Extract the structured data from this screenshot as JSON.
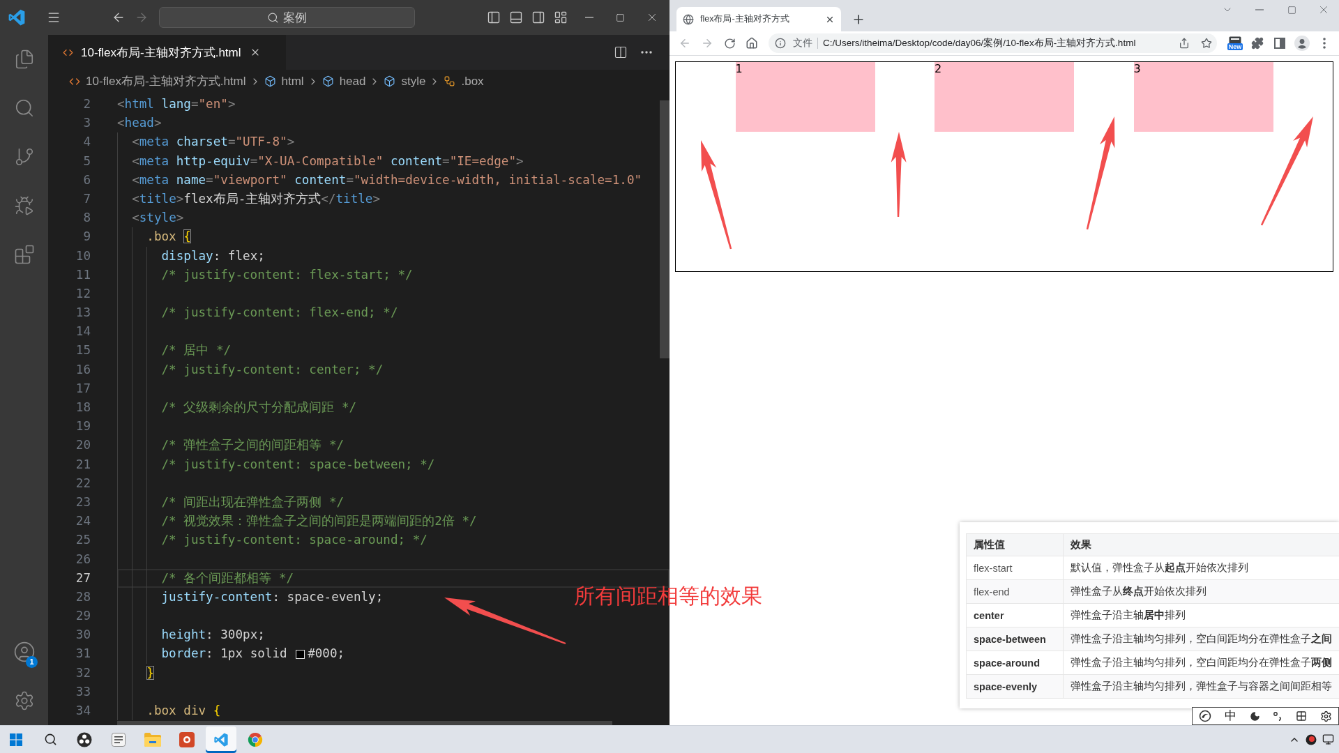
{
  "vscode": {
    "command_center": {
      "label": "案例"
    },
    "tab": {
      "label": "10-flex布局-主轴对齐方式.html",
      "selected": true
    },
    "breadcrumbs": [
      {
        "kind": "file",
        "label": "10-flex布局-主轴对齐方式.html"
      },
      {
        "kind": "element",
        "label": "html"
      },
      {
        "kind": "element",
        "label": "head"
      },
      {
        "kind": "element",
        "label": "style"
      },
      {
        "kind": "selector",
        "label": ".box"
      }
    ],
    "accounts_badge": "1",
    "lines": [
      {
        "number": "2",
        "current": false,
        "tokens": [
          {
            "kind": "punct",
            "text": "<"
          },
          {
            "kind": "tag",
            "text": "html"
          },
          {
            "kind": "attr",
            "text": " lang"
          },
          {
            "kind": "punct",
            "text": "="
          },
          {
            "kind": "string",
            "text": "\"en\""
          },
          {
            "kind": "punct",
            "text": ">"
          }
        ]
      },
      {
        "number": "3",
        "current": false,
        "tokens": [
          {
            "kind": "punct",
            "text": "<"
          },
          {
            "kind": "tag",
            "text": "head"
          },
          {
            "kind": "punct",
            "text": ">"
          }
        ]
      },
      {
        "number": "4",
        "current": false,
        "tokens": [
          {
            "kind": "punct",
            "text": "  <"
          },
          {
            "kind": "tag",
            "text": "meta"
          },
          {
            "kind": "attr",
            "text": " charset"
          },
          {
            "kind": "punct",
            "text": "="
          },
          {
            "kind": "string",
            "text": "\"UTF-8\""
          },
          {
            "kind": "punct",
            "text": ">"
          }
        ]
      },
      {
        "number": "5",
        "current": false,
        "tokens": [
          {
            "kind": "punct",
            "text": "  <"
          },
          {
            "kind": "tag",
            "text": "meta"
          },
          {
            "kind": "attr",
            "text": " http-equiv"
          },
          {
            "kind": "punct",
            "text": "="
          },
          {
            "kind": "string",
            "text": "\"X-UA-Compatible\""
          },
          {
            "kind": "attr",
            "text": " content"
          },
          {
            "kind": "punct",
            "text": "="
          },
          {
            "kind": "string",
            "text": "\"IE=edge\""
          },
          {
            "kind": "punct",
            "text": ">"
          }
        ]
      },
      {
        "number": "6",
        "current": false,
        "tokens": [
          {
            "kind": "punct",
            "text": "  <"
          },
          {
            "kind": "tag",
            "text": "meta"
          },
          {
            "kind": "attr",
            "text": " name"
          },
          {
            "kind": "punct",
            "text": "="
          },
          {
            "kind": "string",
            "text": "\"viewport\""
          },
          {
            "kind": "attr",
            "text": " content"
          },
          {
            "kind": "punct",
            "text": "="
          },
          {
            "kind": "string",
            "text": "\"width=device-width, initial-scale=1.0\""
          }
        ]
      },
      {
        "number": "7",
        "current": false,
        "tokens": [
          {
            "kind": "punct",
            "text": "  <"
          },
          {
            "kind": "tag",
            "text": "title"
          },
          {
            "kind": "punct",
            "text": ">"
          },
          {
            "kind": "text",
            "text": "flex布局-主轴对齐方式"
          },
          {
            "kind": "punct",
            "text": "</"
          },
          {
            "kind": "tag",
            "text": "title"
          },
          {
            "kind": "punct",
            "text": ">"
          }
        ]
      },
      {
        "number": "8",
        "current": false,
        "tokens": [
          {
            "kind": "punct",
            "text": "  <"
          },
          {
            "kind": "tag",
            "text": "style"
          },
          {
            "kind": "punct",
            "text": ">"
          }
        ]
      },
      {
        "number": "9",
        "current": false,
        "tokens": [
          {
            "kind": "selector",
            "text": "    .box "
          },
          {
            "kind": "bracket_match",
            "text": "{"
          }
        ]
      },
      {
        "number": "10",
        "current": false,
        "tokens": [
          {
            "kind": "property",
            "text": "      display"
          },
          {
            "kind": "text",
            "text": ": flex;"
          }
        ]
      },
      {
        "number": "11",
        "current": false,
        "tokens": [
          {
            "kind": "comment",
            "text": "      /* justify-content: flex-start; */"
          }
        ]
      },
      {
        "number": "12",
        "current": false
      },
      {
        "number": "13",
        "current": false,
        "tokens": [
          {
            "kind": "comment",
            "text": "      /* justify-content: flex-end; */"
          }
        ]
      },
      {
        "number": "14",
        "current": false
      },
      {
        "number": "15",
        "current": false,
        "tokens": [
          {
            "kind": "comment",
            "text": "      /* 居中 */"
          }
        ]
      },
      {
        "number": "16",
        "current": false,
        "tokens": [
          {
            "kind": "comment",
            "text": "      /* justify-content: center; */"
          }
        ]
      },
      {
        "number": "17",
        "current": false
      },
      {
        "number": "18",
        "current": false,
        "tokens": [
          {
            "kind": "comment",
            "text": "      /* 父级剩余的尺寸分配成间距 */"
          }
        ]
      },
      {
        "number": "19",
        "current": false
      },
      {
        "number": "20",
        "current": false,
        "tokens": [
          {
            "kind": "comment",
            "text": "      /* 弹性盒子之间的间距相等 */"
          }
        ]
      },
      {
        "number": "21",
        "current": false,
        "tokens": [
          {
            "kind": "comment",
            "text": "      /* justify-content: space-between; */"
          }
        ]
      },
      {
        "number": "22",
        "current": false
      },
      {
        "number": "23",
        "current": false,
        "tokens": [
          {
            "kind": "comment",
            "text": "      /* 间距出现在弹性盒子两侧 */"
          }
        ]
      },
      {
        "number": "24",
        "current": false,
        "tokens": [
          {
            "kind": "comment",
            "text": "      /* 视觉效果：弹性盒子之间的间距是两端间距的2倍 */"
          }
        ]
      },
      {
        "number": "25",
        "current": false,
        "tokens": [
          {
            "kind": "comment",
            "text": "      /* justify-content: space-around; */"
          }
        ]
      },
      {
        "number": "26",
        "current": false
      },
      {
        "number": "27",
        "current": true,
        "tokens": [
          {
            "kind": "comment",
            "text": "      /* 各个间距都相等 */"
          }
        ]
      },
      {
        "number": "28",
        "current": false,
        "tokens": [
          {
            "kind": "property",
            "text": "      justify-content"
          },
          {
            "kind": "text",
            "text": ": space-evenly;"
          }
        ]
      },
      {
        "number": "29",
        "current": false
      },
      {
        "number": "30",
        "current": false,
        "tokens": [
          {
            "kind": "property",
            "text": "      height"
          },
          {
            "kind": "text",
            "text": ": 300px;"
          }
        ]
      },
      {
        "number": "31",
        "current": false,
        "tokens": [
          {
            "kind": "property",
            "text": "      border"
          },
          {
            "kind": "text",
            "text": ": 1px solid "
          },
          {
            "kind": "swatch",
            "color": "#000000"
          },
          {
            "kind": "text",
            "text": "#000;"
          }
        ]
      },
      {
        "number": "32",
        "current": false,
        "tokens": [
          {
            "kind": "bracket_match",
            "text": "    }"
          }
        ]
      },
      {
        "number": "33",
        "current": false
      },
      {
        "number": "34",
        "current": false,
        "tokens": [
          {
            "kind": "selector",
            "text": "    .box div "
          },
          {
            "kind": "bracket",
            "text": "{"
          }
        ]
      }
    ]
  },
  "annotation": {
    "text": "所有间距相等的效果"
  },
  "browser": {
    "tab": {
      "title": "flex布局-主轴对齐方式",
      "selected": true
    },
    "address": {
      "scheme": "文件",
      "url": "C:/Users/itheima/Desktop/code/day06/案例/10-flex布局-主轴对齐方式.html"
    },
    "extension_badge": "New",
    "page": {
      "items": [
        "1",
        "2",
        "3"
      ]
    }
  },
  "reference_table": {
    "columns": [
      "属性值",
      "效果"
    ],
    "rows": [
      {
        "value": "flex-start",
        "bold": false,
        "effect": "默认值，弹性盒子从**起点**开始依次排列"
      },
      {
        "value": "flex-end",
        "bold": false,
        "effect": "弹性盒子从**终点**开始依次排列"
      },
      {
        "value": "center",
        "bold": true,
        "effect": "弹性盒子沿主轴**居中**排列"
      },
      {
        "value": "space-between",
        "bold": true,
        "effect": "弹性盒子沿主轴均匀排列，空白间距均分在弹性盒子**之间**"
      },
      {
        "value": "space-around",
        "bold": true,
        "effect": "弹性盒子沿主轴均匀排列，空白间距均分在弹性盒子**两侧**"
      },
      {
        "value": "space-evenly",
        "bold": true,
        "effect": "弹性盒子沿主轴均匀排列，弹性盒子与容器之间间距相等"
      }
    ]
  },
  "ime_bar": {
    "mode": "中"
  },
  "taskbar": {
    "apps": [
      {
        "kind": "recorder",
        "selected": false
      },
      {
        "kind": "notes",
        "selected": false
      },
      {
        "kind": "folder",
        "selected": false
      },
      {
        "kind": "slides",
        "selected": false
      },
      {
        "kind": "code_editor",
        "selected": true
      },
      {
        "kind": "browser",
        "selected": false
      }
    ]
  }
}
